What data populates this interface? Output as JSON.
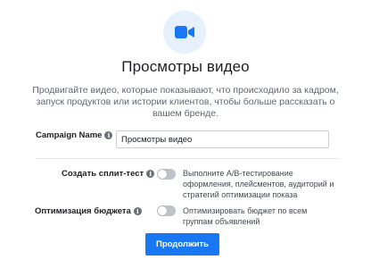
{
  "hero": {
    "icon": "video-camera-icon",
    "accent_color": "#1877f2",
    "icon_bg_color": "#e7f0fd"
  },
  "title": "Просмотры видео",
  "description": "Продвигайте видео, которые показывают, что происходило за кадром, запуск продуктов или истории клиентов, чтобы больше рассказать о вашем бренде.",
  "campaign_name": {
    "label": "Campaign Name",
    "info_icon": "info-icon",
    "value": "Просмотры видео"
  },
  "split_test": {
    "label": "Создать сплит-тест",
    "info_icon": "info-icon",
    "toggle_on": false,
    "help": "Выполните A/B-тестирование оформления, плейсментов, аудиторий и стратегий оптимизации показа"
  },
  "budget_optimization": {
    "label": "Оптимизация бюджета",
    "info_icon": "info-icon",
    "toggle_on": false,
    "help": "Оптимизировать бюджет по всем группам объявлений"
  },
  "continue_button": {
    "label": "Продолжить",
    "color": "#1877f2"
  }
}
